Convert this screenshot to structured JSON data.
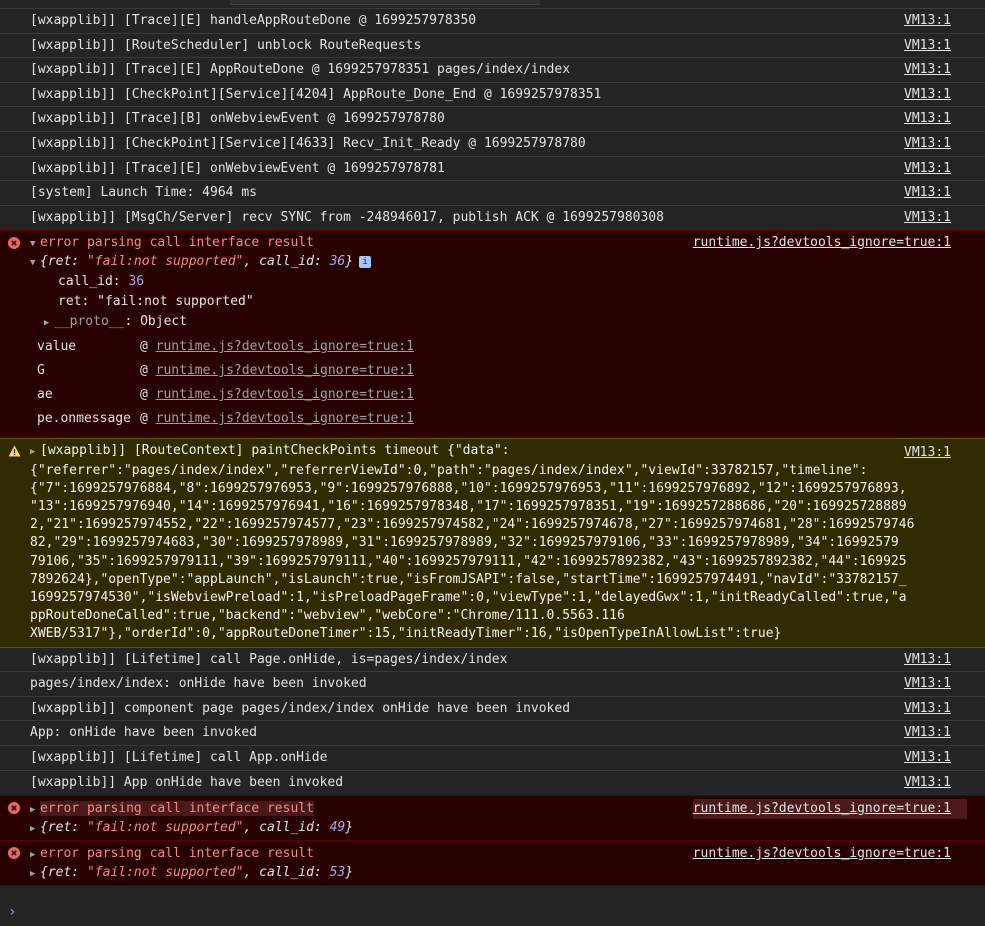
{
  "log_rows_top": [
    {
      "text": "[wxapplib]] [Trace][E] handleAppRouteDone @ 1699257978350",
      "src": "VM13:1"
    },
    {
      "text": "[wxapplib]] [RouteScheduler] unblock RouteRequests",
      "src": "VM13:1"
    },
    {
      "text": "[wxapplib]] [Trace][E] AppRouteDone @ 1699257978351 pages/index/index",
      "src": "VM13:1"
    },
    {
      "text": "[wxapplib]] [CheckPoint][Service][4204] AppRoute_Done_End @ 1699257978351",
      "src": "VM13:1"
    },
    {
      "text": "[wxapplib]] [Trace][B] onWebviewEvent @ 1699257978780",
      "src": "VM13:1"
    },
    {
      "text": "[wxapplib]] [CheckPoint][Service][4633] Recv_Init_Ready @ 1699257978780",
      "src": "VM13:1"
    },
    {
      "text": "[wxapplib]] [Trace][E] onWebviewEvent @ 1699257978781",
      "src": "VM13:1"
    },
    {
      "text": "[system] Launch Time: 4964 ms",
      "src": "VM13:1"
    },
    {
      "text": "[wxapplib]] [MsgCh/Server] recv SYNC from -248946017, publish ACK @ 1699257980308",
      "src": "VM13:1"
    }
  ],
  "error1": {
    "message": "error parsing call interface result",
    "src": "runtime.js?devtools_ignore=true:1",
    "obj_open": "{ret: ",
    "obj_ret": "\"fail:not supported\"",
    "obj_mid": ", call_id: ",
    "obj_id": "36",
    "obj_close": "}",
    "prop_call_id_key": "call_id: ",
    "prop_call_id_val": "36",
    "prop_ret_key": "ret: ",
    "prop_ret_val": "\"fail:not supported\"",
    "proto_key": "__proto__",
    "proto_val": ": Object",
    "stack": [
      {
        "fn": "value",
        "at": "@",
        "link": "runtime.js?devtools_ignore=true:1"
      },
      {
        "fn": "G",
        "at": "@",
        "link": "runtime.js?devtools_ignore=true:1"
      },
      {
        "fn": "ae",
        "at": "@",
        "link": "runtime.js?devtools_ignore=true:1"
      },
      {
        "fn": "pe.onmessage",
        "at": "@",
        "link": "runtime.js?devtools_ignore=true:1"
      }
    ]
  },
  "warning": {
    "text": "[wxapplib]] [RouteContext] paintCheckPoints timeout {\"data\":\n{\"referrer\":\"pages/index/index\",\"referrerViewId\":0,\"path\":\"pages/index/index\",\"viewId\":33782157,\"timeline\":\n{\"7\":1699257976884,\"8\":1699257976953,\"9\":1699257976888,\"10\":1699257976953,\"11\":1699257976892,\"12\":1699257976893,\n\"13\":1699257976940,\"14\":1699257976941,\"16\":1699257978348,\"17\":1699257978351,\"19\":1699257288686,\"20\":169925728889\n2,\"21\":1699257974552,\"22\":1699257974577,\"23\":1699257974582,\"24\":1699257974678,\"27\":1699257974681,\"28\":16992579746\n82,\"29\":1699257974683,\"30\":1699257978989,\"31\":1699257978989,\"32\":1699257979106,\"33\":1699257978989,\"34\":16992579\n79106,\"35\":1699257979111,\"39\":1699257979111,\"40\":1699257979111,\"42\":1699257892382,\"43\":1699257892382,\"44\":169925\n7892624},\"openType\":\"appLaunch\",\"isLaunch\":true,\"isFromJSAPI\":false,\"startTime\":1699257974491,\"navId\":\"33782157_\n1699257974530\",\"isWebviewPreload\":1,\"isPreloadPageFrame\":0,\"viewType\":1,\"delayedGwx\":1,\"initReadyCalled\":true,\"a\nppRouteDoneCalled\":true,\"backend\":\"webview\",\"webCore\":\"Chrome/111.0.5563.116\nXWEB/5317\"},\"orderId\":0,\"appRouteDoneTimer\":15,\"initReadyTimer\":16,\"isOpenTypeInAllowList\":true}",
    "src": "VM13:1"
  },
  "log_rows_mid": [
    {
      "text": "[wxapplib]] [Lifetime] call Page.onHide, is=pages/index/index",
      "src": "VM13:1"
    },
    {
      "text": "pages/index/index: onHide have been invoked",
      "src": "VM13:1"
    },
    {
      "text": "[wxapplib]] component page pages/index/index onHide have been invoked",
      "src": "VM13:1"
    },
    {
      "text": "App: onHide have been invoked",
      "src": "VM13:1"
    },
    {
      "text": "[wxapplib]] [Lifetime] call App.onHide",
      "src": "VM13:1"
    },
    {
      "text": "[wxapplib]] App onHide have been invoked",
      "src": "VM13:1"
    }
  ],
  "error2": {
    "message": "error parsing call interface result",
    "src": "runtime.js?devtools_ignore=true:1",
    "obj_open": "{ret: ",
    "obj_ret": "\"fail:not supported\"",
    "obj_mid": ", call_id: ",
    "obj_id": "49",
    "obj_close": "}"
  },
  "error3": {
    "message": "error parsing call interface result",
    "src": "runtime.js?devtools_ignore=true:1",
    "obj_open": "{ret: ",
    "obj_ret": "\"fail:not supported\"",
    "obj_mid": ", call_id: ",
    "obj_id": "53",
    "obj_close": "}"
  },
  "prompt_glyph": "›",
  "icons": {
    "error": "error-circle-icon",
    "warning": "warning-triangle-icon",
    "expand": "expand-triangle-icon"
  },
  "colors": {
    "background": "#242424",
    "error_bg": "#290000",
    "warning_bg": "#332b00",
    "error_text": "#f28b82",
    "number": "#a8a4f8"
  }
}
